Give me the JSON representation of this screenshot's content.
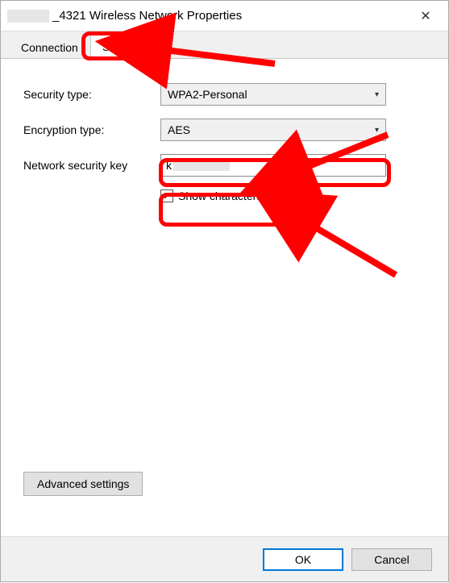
{
  "window": {
    "title_suffix": "_4321 Wireless Network Properties",
    "close_label": "✕"
  },
  "tabs": {
    "connection": "Connection",
    "security": "Security"
  },
  "form": {
    "security_type_label": "Security type:",
    "security_type_value": "WPA2-Personal",
    "encryption_type_label": "Encryption type:",
    "encryption_type_value": "AES",
    "network_key_label": "Network security key",
    "network_key_value_visible": "k",
    "show_characters_label": "Show characters",
    "show_characters_checked": "✓"
  },
  "buttons": {
    "advanced": "Advanced settings",
    "ok": "OK",
    "cancel": "Cancel"
  },
  "annotation_color": "#ff0000"
}
